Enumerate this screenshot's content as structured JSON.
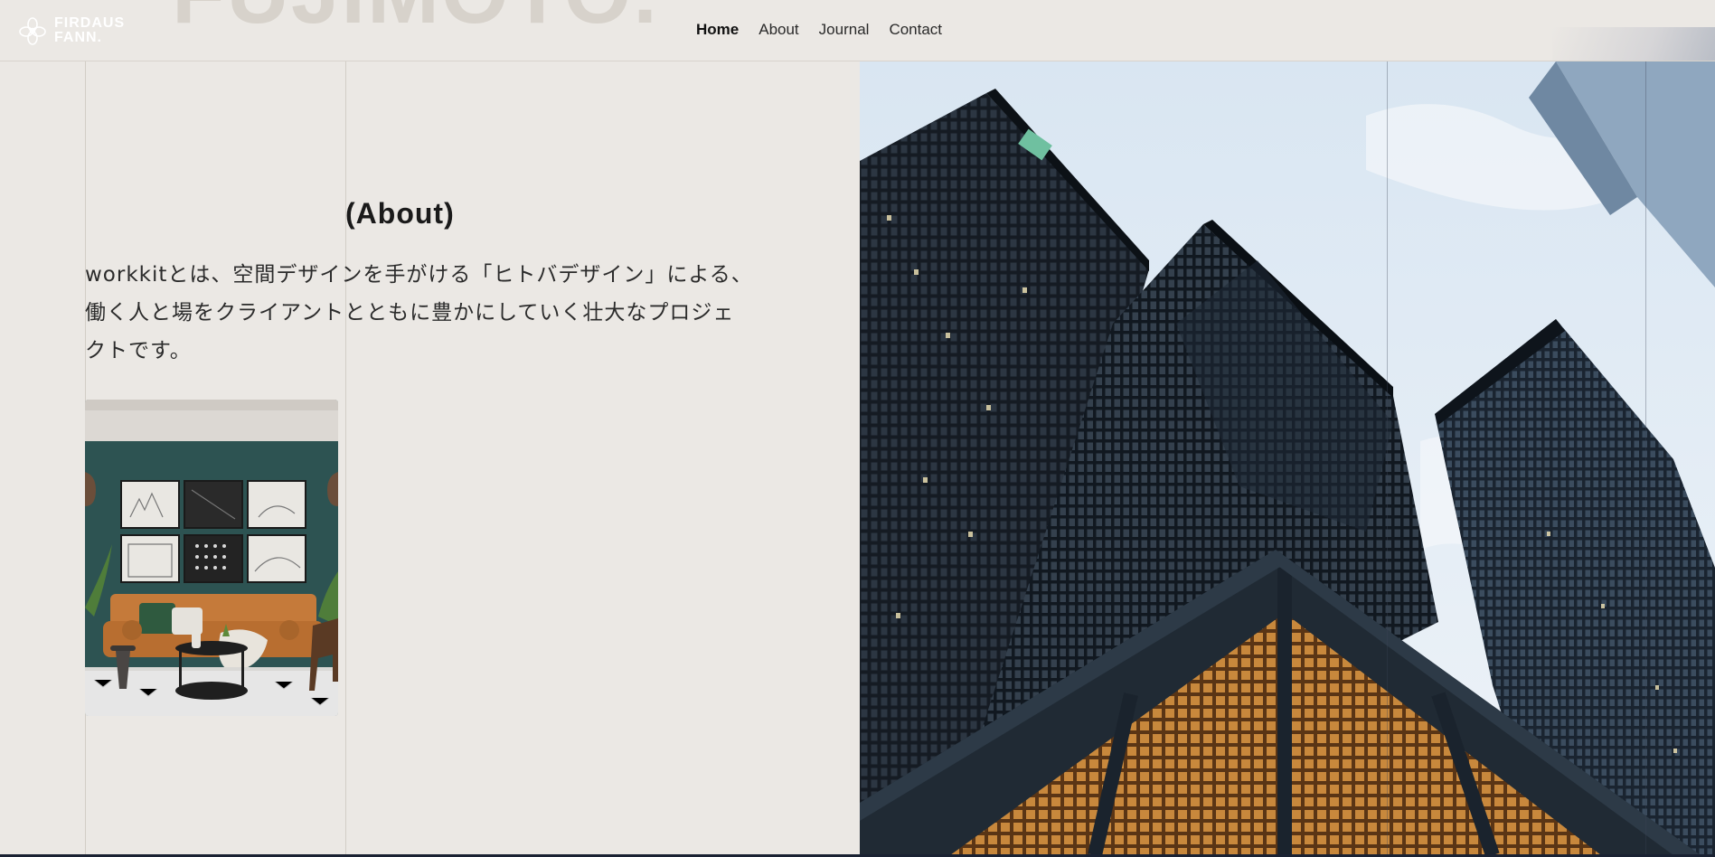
{
  "header": {
    "background_word": "FUJIMOTO.",
    "logo": {
      "line1": "FIRDAUS",
      "line2": "FANN.",
      "icon": "flower-icon"
    },
    "nav": [
      {
        "label": "Home",
        "active": true
      },
      {
        "label": "About",
        "active": false
      },
      {
        "label": "Journal",
        "active": false
      },
      {
        "label": "Contact",
        "active": false
      }
    ]
  },
  "about": {
    "title": "(About)",
    "lines": [
      "workkitとは、空間デザインを手がける「ヒトバデザイン」による、",
      "働く人と場をクライアントとともに豊かにしていく壮大なプロジェ",
      "クトです。"
    ]
  },
  "images": {
    "room": "living-room-photo",
    "buildings": "skyscrapers-photo"
  },
  "colors": {
    "background": "#ebe8e4",
    "text": "#1c1c1c",
    "room_wall": "#2d5352",
    "sky": "#d9e6f2"
  }
}
